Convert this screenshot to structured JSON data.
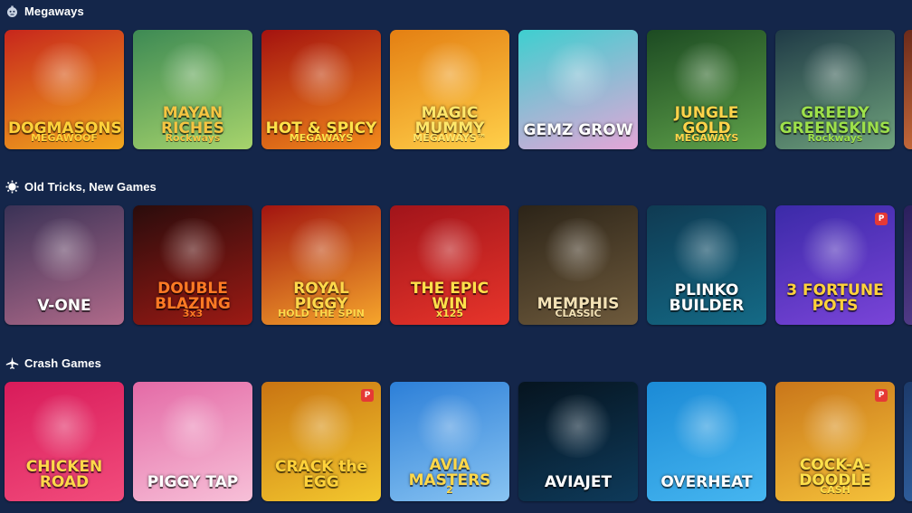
{
  "sections": [
    {
      "title": "Megaways",
      "icon": "bomb-icon",
      "games": [
        {
          "label": "DOGMASONS",
          "sub": "MEGAWOOF",
          "colors": [
            "#c7261c",
            "#f2a81d"
          ],
          "label_color": "#ffd23a",
          "badge": ""
        },
        {
          "label": "MAYAN RICHES",
          "sub": "Rockways",
          "colors": [
            "#3d8a54",
            "#a7d46c"
          ],
          "label_color": "#f5c542",
          "badge": ""
        },
        {
          "label": "HOT & SPICY",
          "sub": "MEGAWAYS",
          "colors": [
            "#a4120f",
            "#f28a1c"
          ],
          "label_color": "#ffe24a",
          "badge": ""
        },
        {
          "label": "MAGIC MUMMY",
          "sub": "MEGAWAYS™",
          "colors": [
            "#e47f12",
            "#ffd04a"
          ],
          "label_color": "#ffe76a",
          "badge": ""
        },
        {
          "label": "GEMZ GROW",
          "sub": "",
          "colors": [
            "#3ecfcf",
            "#e4a6d8"
          ],
          "label_color": "#ffffff",
          "badge": ""
        },
        {
          "label": "JUNGLE GOLD",
          "sub": "MEGAWAYS",
          "colors": [
            "#1c4a22",
            "#5fa24a"
          ],
          "label_color": "#ffd34a",
          "badge": ""
        },
        {
          "label": "GREEDY GREENSKINS",
          "sub": "Rockways",
          "colors": [
            "#1f3a46",
            "#6fa27c"
          ],
          "label_color": "#9de04a",
          "badge": ""
        },
        {
          "label": "",
          "sub": "",
          "colors": [
            "#6b2a1a",
            "#c4683a"
          ],
          "label_color": "#ffffff",
          "badge": ""
        }
      ]
    },
    {
      "title": "Old Tricks, New Games",
      "icon": "sun-icon",
      "games": [
        {
          "label": "V-ONE",
          "sub": "",
          "colors": [
            "#3a3256",
            "#b06a8a"
          ],
          "label_color": "#ffffff",
          "badge": ""
        },
        {
          "label": "DOUBLE BLAZING",
          "sub": "3x3",
          "colors": [
            "#2a0c0c",
            "#9c1a14"
          ],
          "label_color": "#ff7a24",
          "badge": ""
        },
        {
          "label": "ROYAL PIGGY",
          "sub": "HOLD THE SPIN",
          "colors": [
            "#a21410",
            "#f6a62c"
          ],
          "label_color": "#ffd84a",
          "badge": ""
        },
        {
          "label": "THE EPIC WIN",
          "sub": "x125",
          "colors": [
            "#a1141a",
            "#e8352b"
          ],
          "label_color": "#ffe04a",
          "badge": ""
        },
        {
          "label": "MEMPHIS",
          "sub": "CLASSIC",
          "colors": [
            "#2c2418",
            "#6e5a3c"
          ],
          "label_color": "#f3e2b6",
          "badge": ""
        },
        {
          "label": "PLINKO BUILDER",
          "sub": "",
          "colors": [
            "#0f3a52",
            "#146a86"
          ],
          "label_color": "#ffffff",
          "badge": ""
        },
        {
          "label": "3 FORTUNE POTS",
          "sub": "",
          "colors": [
            "#3b2aa8",
            "#7a44d8"
          ],
          "label_color": "#ffd23a",
          "badge": "P"
        },
        {
          "label": "",
          "sub": "",
          "colors": [
            "#2a1f5c",
            "#503a86"
          ],
          "label_color": "#ffffff",
          "badge": ""
        }
      ]
    },
    {
      "title": "Crash Games",
      "icon": "plane-icon",
      "games": [
        {
          "label": "CHICKEN ROAD",
          "sub": "",
          "colors": [
            "#d81b5a",
            "#f24c7c"
          ],
          "label_color": "#ffd84a",
          "badge": ""
        },
        {
          "label": "PIGGY TAP",
          "sub": "",
          "colors": [
            "#e46aa6",
            "#f7c0d8"
          ],
          "label_color": "#ffffff",
          "badge": ""
        },
        {
          "label": "CRACK the EGG",
          "sub": "",
          "colors": [
            "#c97412",
            "#f3c82e"
          ],
          "label_color": "#ffd23a",
          "badge": "P"
        },
        {
          "label": "AVIA MASTERS",
          "sub": "2",
          "colors": [
            "#2c7fd8",
            "#89c4f2"
          ],
          "label_color": "#ffd84a",
          "badge": ""
        },
        {
          "label": "AVIAJET",
          "sub": "",
          "colors": [
            "#06141f",
            "#0e3a5a"
          ],
          "label_color": "#ffffff",
          "badge": ""
        },
        {
          "label": "OVERHEAT",
          "sub": "",
          "colors": [
            "#1b8ad6",
            "#46b6f0"
          ],
          "label_color": "#ffffff",
          "badge": ""
        },
        {
          "label": "COCK-A-DOODLE",
          "sub": "CASH",
          "colors": [
            "#c9761a",
            "#f5c23a"
          ],
          "label_color": "#ffe04a",
          "badge": "P"
        },
        {
          "label": "",
          "sub": "",
          "colors": [
            "#1c3a6a",
            "#2e5c9a"
          ],
          "label_color": "#ffffff",
          "badge": ""
        }
      ]
    }
  ]
}
